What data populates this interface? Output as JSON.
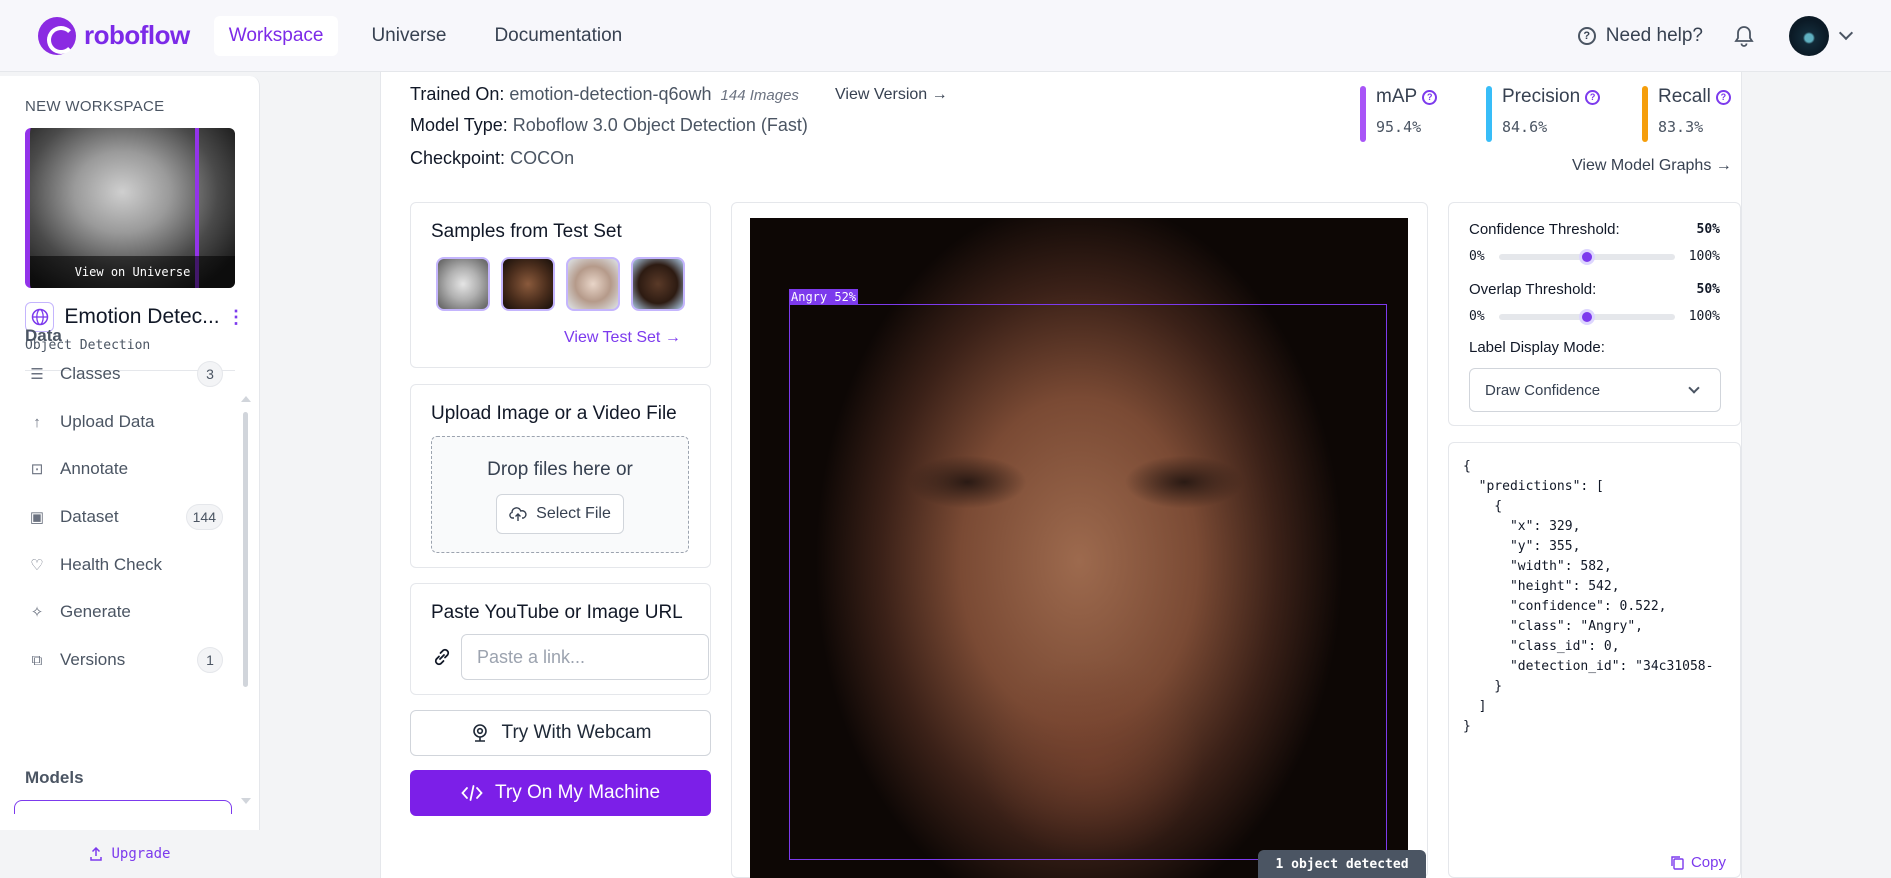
{
  "nav": {
    "logo_text": "roboflow",
    "tabs": [
      "Workspace",
      "Universe",
      "Documentation"
    ],
    "help": "Need help?"
  },
  "sidebar": {
    "workspace_label": "NEW WORKSPACE",
    "view_on_universe": "View on Universe",
    "project_name": "Emotion Detec...",
    "project_type": "Object Detection",
    "data_title": "Data",
    "items": [
      {
        "label": "Classes",
        "icon": "list-icon",
        "badge": "3"
      },
      {
        "label": "Upload Data",
        "icon": "arrow-up-icon",
        "badge": ""
      },
      {
        "label": "Annotate",
        "icon": "annotate-icon",
        "badge": ""
      },
      {
        "label": "Dataset",
        "icon": "images-icon",
        "badge": "144"
      },
      {
        "label": "Health Check",
        "icon": "heart-pulse-icon",
        "badge": ""
      },
      {
        "label": "Generate",
        "icon": "generate-icon",
        "badge": ""
      },
      {
        "label": "Versions",
        "icon": "versions-icon",
        "badge": "1"
      }
    ],
    "models_title": "Models",
    "upgrade": "Upgrade"
  },
  "model": {
    "trained_on_label": "Trained On:",
    "trained_on_value": "emotion-detection-q6owh",
    "images_count": "144 Images",
    "view_version": "View Version",
    "model_type_label": "Model Type:",
    "model_type_value": "Roboflow 3.0 Object Detection (Fast)",
    "checkpoint_label": "Checkpoint:",
    "checkpoint_value": "COCOn",
    "view_graphs": "View Model Graphs"
  },
  "metrics": [
    {
      "label": "mAP",
      "value": "95.4%",
      "color": "#a855f7"
    },
    {
      "label": "Precision",
      "value": "84.6%",
      "color": "#38bdf8"
    },
    {
      "label": "Recall",
      "value": "83.3%",
      "color": "#f59e0b"
    }
  ],
  "samples": {
    "title": "Samples from Test Set",
    "link": "View Test Set"
  },
  "upload": {
    "title": "Upload Image or a Video File",
    "drop_text": "Drop files here or",
    "select_file": "Select File"
  },
  "url": {
    "title": "Paste YouTube or Image URL",
    "placeholder": "Paste a link..."
  },
  "buttons": {
    "webcam": "Try With Webcam",
    "machine": "Try On My Machine"
  },
  "detection": {
    "label": "Angry 52%",
    "count_text": "1 object detected"
  },
  "settings": {
    "confidence_label": "Confidence Threshold:",
    "confidence_value": "50%",
    "overlap_label": "Overlap Threshold:",
    "overlap_value": "50%",
    "min": "0%",
    "max": "100%",
    "confidence_level": 0.5,
    "overlap_level": 0.5,
    "label_mode_title": "Label Display Mode:",
    "label_mode_value": "Draw Confidence"
  },
  "json_output": {
    "text": "{\n  \"predictions\": [\n    {\n      \"x\": 329,\n      \"y\": 355,\n      \"width\": 582,\n      \"height\": 542,\n      \"confidence\": 0.522,\n      \"class\": \"Angry\",\n      \"class_id\": 0,\n      \"detection_id\": \"34c31058-\n    }\n  ]\n}",
    "copy": "Copy"
  }
}
